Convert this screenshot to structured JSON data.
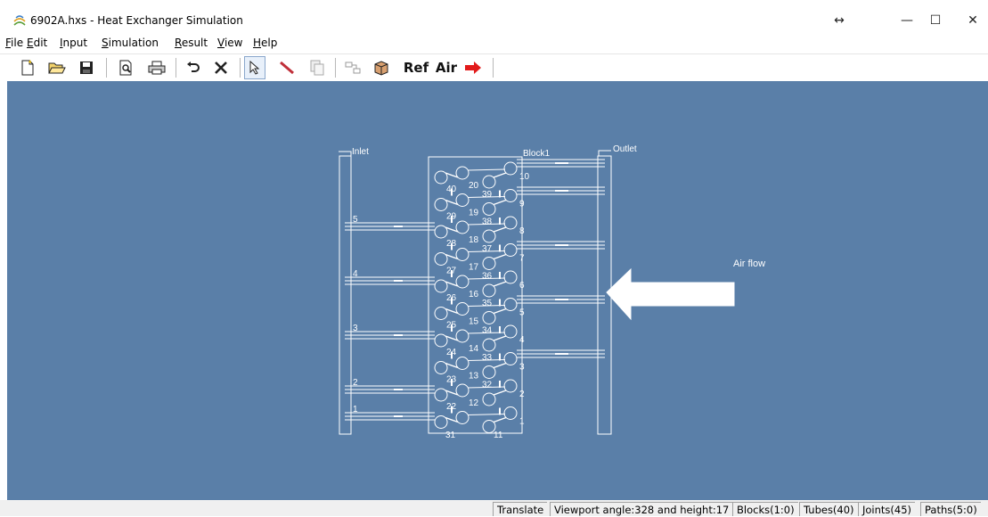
{
  "window": {
    "title": "6902A.hxs - Heat Exchanger Simulation",
    "controls": {
      "resize": "↔",
      "minimize": "—",
      "maximize": "☐",
      "close": "✕"
    }
  },
  "menubar": [
    {
      "accel": "F",
      "rest": "ile"
    },
    {
      "accel": "E",
      "rest": "dit"
    },
    {
      "accel": "I",
      "rest": "nput"
    },
    {
      "accel": "S",
      "rest": "imulation"
    },
    {
      "accel": "R",
      "rest": "esult"
    },
    {
      "accel": "V",
      "rest": "iew"
    },
    {
      "accel": "H",
      "rest": "elp"
    }
  ],
  "toolbar": {
    "icons": [
      "new-file-icon",
      "open-folder-icon",
      "save-disk-icon",
      "print-preview-icon",
      "printer-icon",
      "undo-icon",
      "delete-x-icon",
      "select-arrow-icon",
      "draw-tube-icon",
      "copy-icon",
      "connect-icon",
      "block-icon"
    ],
    "ref_label": "Ref",
    "air_label": "Air",
    "run_icon": "red-arrow-icon",
    "accent_red": "#e21b1b"
  },
  "diagram": {
    "inlet_label": "Inlet",
    "outlet_label": "Outlet",
    "block_label": "Block1",
    "airflow_label": "Air flow",
    "inlet_numbers": [
      "5",
      "4",
      "3",
      "2",
      "1"
    ],
    "right_column_numbers": [
      "10",
      "9",
      "8",
      "7",
      "6",
      "5",
      "4",
      "3",
      "2",
      "1"
    ],
    "left_column_numbers": [
      "40",
      "29",
      "28",
      "27",
      "26",
      "25",
      "24",
      "23",
      "22"
    ],
    "mid_numbers": [
      "20",
      "19",
      "18",
      "17",
      "16",
      "15",
      "14",
      "13",
      "12"
    ],
    "inner_numbers": [
      "39",
      "38",
      "37",
      "36",
      "35",
      "34",
      "33",
      "32"
    ],
    "bottom_numbers": [
      "31",
      "11"
    ],
    "background": "#5a7fa8",
    "line_color": "#ffffff"
  },
  "statusbar": {
    "mode": "Translate",
    "viewport": "Viewport angle:328 and height:17",
    "blocks": "Blocks(1:0)",
    "tubes": "Tubes(40)",
    "joints": "Joints(45)",
    "paths": "Paths(5:0)"
  }
}
